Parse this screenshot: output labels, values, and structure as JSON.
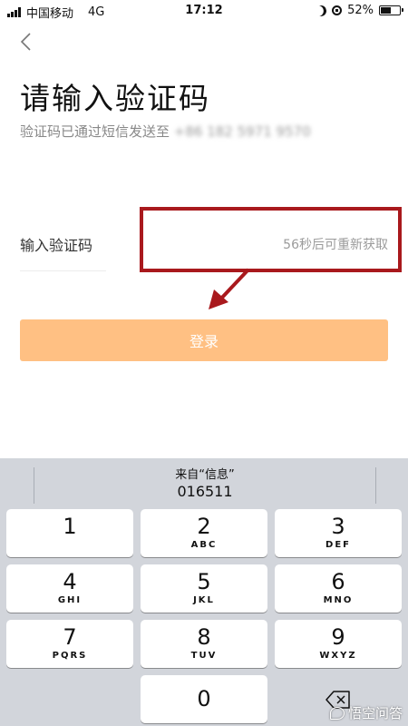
{
  "status_bar": {
    "carrier": "中国移动",
    "network": "4G",
    "time": "17:12",
    "battery_text": "52%",
    "battery_level": 0.52
  },
  "header": {
    "back_icon": "chevron-left-icon",
    "title": "请输入验证码",
    "subtitle_prefix": "验证码已通过短信发送至",
    "phone_masked": "+86 182 5971 9570"
  },
  "form": {
    "code_label": "输入验证码",
    "code_value": "",
    "resend_text": "56秒后可重新获取",
    "login_label": "登录",
    "login_color": "#ffc083"
  },
  "annotation": {
    "color": "#a9191d"
  },
  "keyboard": {
    "suggestion_source": "来自“信息”",
    "suggestion_code": "016511",
    "keys": [
      {
        "digit": "1",
        "letters": ""
      },
      {
        "digit": "2",
        "letters": "ABC"
      },
      {
        "digit": "3",
        "letters": "DEF"
      },
      {
        "digit": "4",
        "letters": "GHI"
      },
      {
        "digit": "5",
        "letters": "JKL"
      },
      {
        "digit": "6",
        "letters": "MNO"
      },
      {
        "digit": "7",
        "letters": "PQRS"
      },
      {
        "digit": "8",
        "letters": "TUV"
      },
      {
        "digit": "9",
        "letters": "WXYZ"
      },
      {
        "digit": "0",
        "letters": ""
      }
    ],
    "delete_icon": "backspace-icon",
    "background": "#d2d5db"
  },
  "watermark": {
    "text": "悟空问答"
  }
}
